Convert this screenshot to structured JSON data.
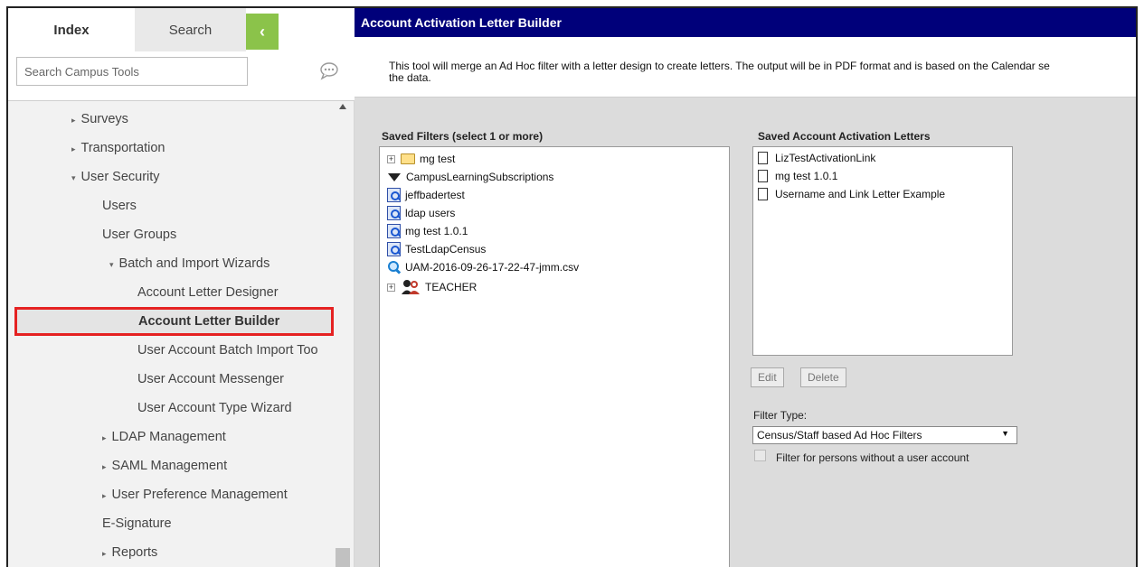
{
  "nav": {
    "tabs": {
      "index": "Index",
      "search": "Search",
      "collapse": "‹"
    },
    "search": {
      "placeholder": "Search Campus Tools"
    },
    "items": [
      {
        "label": "Surveys",
        "expander": "▸"
      },
      {
        "label": "Transportation",
        "expander": "▸"
      },
      {
        "label": "User Security",
        "expander": "▾"
      },
      {
        "label": "Users"
      },
      {
        "label": "User Groups"
      },
      {
        "label": "Batch and Import Wizards",
        "expander": "▾"
      },
      {
        "label": "Account Letter Designer"
      },
      {
        "label": "Account Letter Builder"
      },
      {
        "label": "User Account Batch Import Too"
      },
      {
        "label": "User Account Messenger"
      },
      {
        "label": "User Account Type Wizard"
      },
      {
        "label": "LDAP Management",
        "expander": "▸"
      },
      {
        "label": "SAML Management",
        "expander": "▸"
      },
      {
        "label": "User Preference Management",
        "expander": "▸"
      },
      {
        "label": "E-Signature"
      },
      {
        "label": "Reports",
        "expander": "▸"
      }
    ]
  },
  "main": {
    "title": "Account Activation Letter Builder",
    "description_line1": "This tool will merge an Ad Hoc filter with a letter design to create letters. The output will be in PDF format and is based on the Calendar se",
    "description_line2": "the data.",
    "filters": {
      "label": "Saved Filters (select 1 or more)",
      "items": [
        {
          "label": "mg test",
          "icon": "folder-icon",
          "expander": "+"
        },
        {
          "label": "CampusLearningSubscriptions",
          "icon": "funnel-icon"
        },
        {
          "label": "jeffbadertest",
          "icon": "query-icon"
        },
        {
          "label": "ldap users",
          "icon": "query-icon"
        },
        {
          "label": "mg test 1.0.1",
          "icon": "query-icon"
        },
        {
          "label": "TestLdapCensus",
          "icon": "query-icon"
        },
        {
          "label": "UAM-2016-09-26-17-22-47-jmm.csv",
          "icon": "magnifier-icon"
        },
        {
          "label": "TEACHER",
          "icon": "people-icon",
          "expander": "+"
        }
      ]
    },
    "letters": {
      "label": "Saved Account Activation Letters",
      "items": [
        {
          "label": "LizTestActivationLink"
        },
        {
          "label": "mg test 1.0.1"
        },
        {
          "label": "Username and Link Letter Example"
        }
      ]
    },
    "buttons": {
      "edit": "Edit",
      "delete": "Delete"
    },
    "filter_type": {
      "label": "Filter Type:",
      "selected": "Census/Staff based Ad Hoc Filters",
      "arrow": "▼"
    },
    "checkbox": {
      "label": "Filter for persons without a user account",
      "checked": false
    }
  },
  "colors": {
    "titlebar": "#00007a",
    "collapse_tab": "#8bc34a",
    "highlight_border": "#e52222"
  }
}
